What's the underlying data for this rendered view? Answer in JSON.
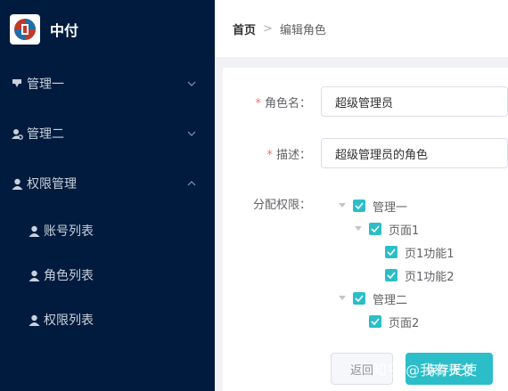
{
  "app": {
    "title": "中付",
    "logo_icon": "app-logo-icon",
    "logo_colors": [
      "#c0392b",
      "#1f6fa8"
    ]
  },
  "sidebar": {
    "items": [
      {
        "label": "管理一",
        "icon": "download-icon",
        "chevron": "down"
      },
      {
        "label": "管理二",
        "icon": "user-gear-icon",
        "chevron": "down"
      },
      {
        "label": "权限管理",
        "icon": "user-icon",
        "chevron": "up",
        "children": [
          {
            "label": "账号列表",
            "icon": "user-icon"
          },
          {
            "label": "角色列表",
            "icon": "user-icon"
          },
          {
            "label": "权限列表",
            "icon": "user-icon"
          }
        ]
      }
    ]
  },
  "breadcrumb": {
    "home": "首页",
    "separator": ">",
    "current": "编辑角色"
  },
  "form": {
    "role_name_label": "角色名：",
    "role_name_value": "超级管理员",
    "desc_label": "描述：",
    "desc_value": "超级管理员的角色",
    "permission_label": "分配权限：",
    "required_mark": "*"
  },
  "tree": [
    {
      "label": "管理一",
      "checked": true,
      "expanded": true
    },
    {
      "label": "页面1",
      "checked": true,
      "expanded": true
    },
    {
      "label": "页1功能1",
      "checked": true
    },
    {
      "label": "页1功能2",
      "checked": true
    },
    {
      "label": "管理二",
      "checked": true,
      "expanded": true
    },
    {
      "label": "页面2",
      "checked": true
    }
  ],
  "buttons": {
    "back": "返回",
    "save": "保存提交"
  },
  "watermark": "知乎 @我有天使",
  "colors": {
    "sidebar_bg": "#001b3d",
    "accent": "#2bbec8",
    "required": "#f56c6c"
  }
}
